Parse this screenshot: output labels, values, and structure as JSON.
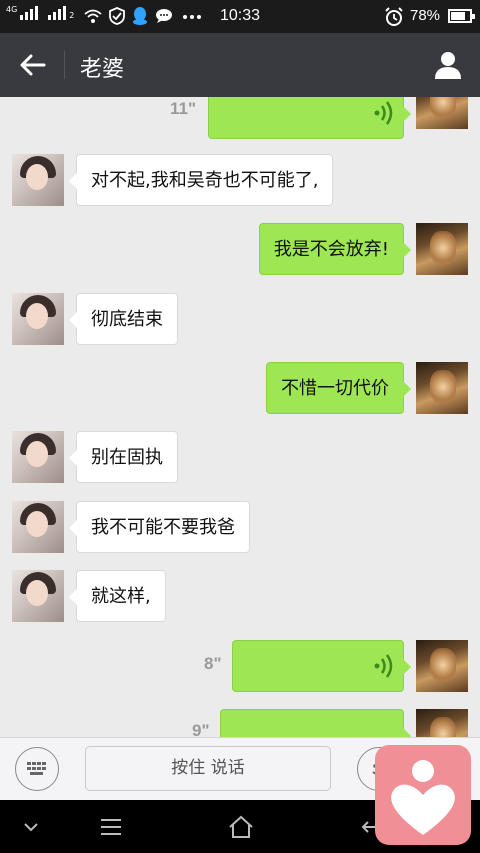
{
  "status_bar": {
    "network_label": "4G",
    "sim_label": "2",
    "time": "10:33",
    "battery_percent": "78%",
    "battery_level": 0.78,
    "icons": [
      "signal-icon",
      "signal-icon",
      "wifi-icon",
      "security-icon",
      "qq-icon",
      "message-icon",
      "more-icon",
      "alarm-icon",
      "battery-icon"
    ]
  },
  "header": {
    "title": "老婆",
    "back_icon": "arrow-left-icon",
    "profile_icon": "person-icon"
  },
  "messages": [
    {
      "side": "right",
      "type": "voice",
      "duration": "11\""
    },
    {
      "side": "left",
      "type": "text",
      "text": "对不起,我和吴奇也不可能了,"
    },
    {
      "side": "right",
      "type": "text",
      "text": "我是不会放弃!"
    },
    {
      "side": "left",
      "type": "text",
      "text": "彻底结束"
    },
    {
      "side": "right",
      "type": "text",
      "text": "不惜一切代价"
    },
    {
      "side": "left",
      "type": "text",
      "text": "别在固执"
    },
    {
      "side": "left",
      "type": "text",
      "text": "我不可能不要我爸"
    },
    {
      "side": "left",
      "type": "text",
      "text": "就这样,"
    },
    {
      "side": "right",
      "type": "voice",
      "duration": "8\""
    },
    {
      "side": "right",
      "type": "voice",
      "duration": "9\""
    }
  ],
  "input_bar": {
    "hold_to_talk": "按住 说话",
    "keyboard_icon": "keyboard-icon",
    "emoji_icon": "emoji-icon"
  },
  "nav_bar": {
    "icons": [
      "chevron-down-icon",
      "menu-icon",
      "home-icon",
      "back-icon"
    ]
  },
  "colors": {
    "title_bar": "#393a3f",
    "sent_bubble": "#9ee653",
    "received_bubble": "#ffffff",
    "chat_background": "#ebebeb",
    "overlay_logo": "#f08f96"
  }
}
